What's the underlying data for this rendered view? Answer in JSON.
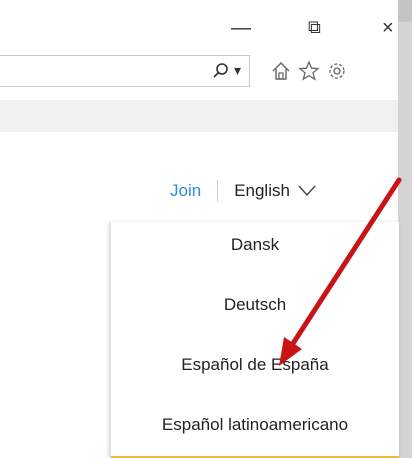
{
  "window": {
    "minimize_glyph": "—",
    "restore_glyph": "⧉",
    "close_glyph": "×"
  },
  "address_bar": {
    "search_dropdown_glyph": "▾"
  },
  "icons": [
    "search-icon",
    "home-icon",
    "star-icon",
    "gear-icon"
  ],
  "nav": {
    "join_label": "Join",
    "language_label": "English"
  },
  "language_menu": {
    "items": [
      "Dansk",
      "Deutsch",
      "Español de España",
      "Español latinoamericano"
    ]
  },
  "colors": {
    "link": "#2b8fd6",
    "annotation_arrow": "#c81414",
    "menu_underline": "#e9b949"
  }
}
